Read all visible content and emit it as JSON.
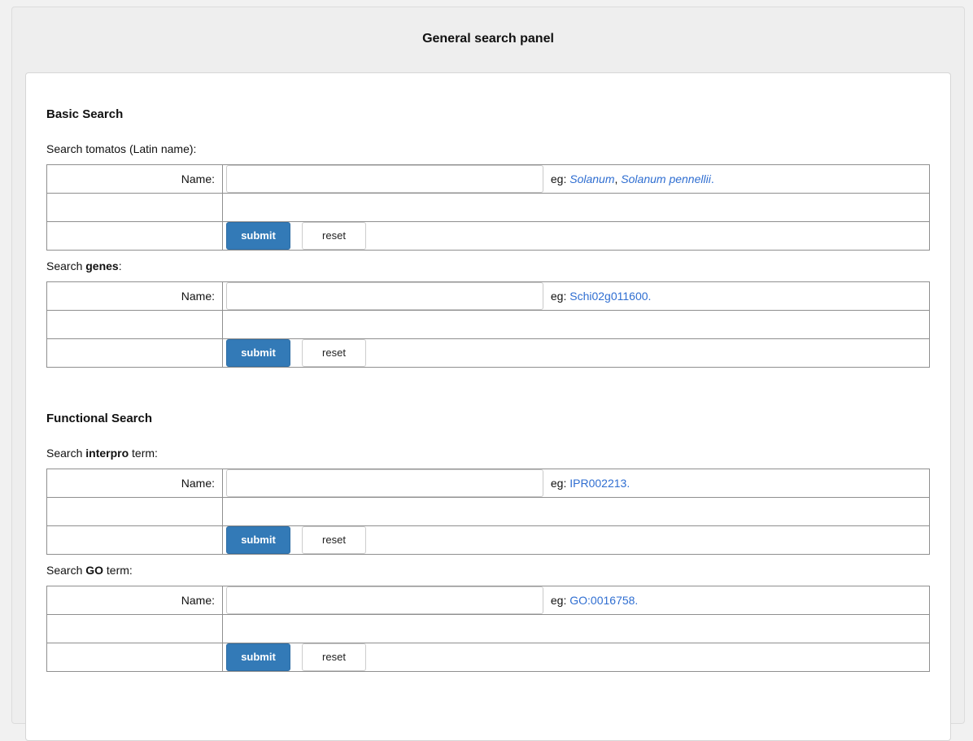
{
  "panel_title": "General search panel",
  "sections": [
    {
      "title": "Basic Search",
      "forms": [
        {
          "caption_pre": "Search tomatos (Latin name):",
          "caption_bold": "",
          "caption_post": "",
          "label": "Name:",
          "input_value": "",
          "eg_prefix": "eg:",
          "examples": [
            "Solanum",
            "Solanum pennellii"
          ],
          "submit": "submit",
          "reset": "reset"
        },
        {
          "caption_pre": "Search ",
          "caption_bold": "genes",
          "caption_post": ":",
          "label": "Name:",
          "input_value": "",
          "eg_prefix": "eg:",
          "examples": [
            "Schi02g011600"
          ],
          "submit": "submit",
          "reset": "reset"
        }
      ]
    },
    {
      "title": "Functional Search",
      "forms": [
        {
          "caption_pre": "Search ",
          "caption_bold": "interpro",
          "caption_post": " term:",
          "label": "Name:",
          "input_value": "",
          "eg_prefix": "eg:",
          "examples": [
            "IPR002213"
          ],
          "submit": "submit",
          "reset": "reset"
        },
        {
          "caption_pre": "Search ",
          "caption_bold": "GO",
          "caption_post": " term:",
          "label": "Name:",
          "input_value": "",
          "eg_prefix": "eg:",
          "examples": [
            "GO:0016758"
          ],
          "submit": "submit",
          "reset": "reset"
        }
      ]
    }
  ],
  "colors": {
    "link": "#2f6ed1",
    "primary_button": "#337ab7"
  }
}
